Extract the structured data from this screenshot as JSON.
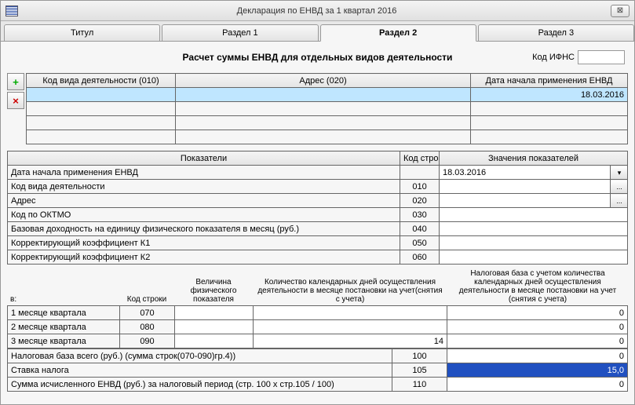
{
  "window": {
    "title": "Декларация по ЕНВД за 1 квартал 2016"
  },
  "tabs": {
    "t0": "Титул",
    "t1": "Раздел 1",
    "t2": "Раздел 2",
    "t3": "Раздел 3"
  },
  "header": {
    "main": "Расчет суммы ЕНВД для отдельных видов деятельности",
    "kod_ifns_label": "Код ИФНС",
    "kod_ifns_value": ""
  },
  "top_grid": {
    "h0": "Код вида деятельности (010)",
    "h1": "Адрес (020)",
    "h2": "Дата начала применения ЕНВД",
    "row0": {
      "c0": "",
      "c1": "",
      "c2": "18.03.2016"
    }
  },
  "params": {
    "h_pokaz": "Показатели",
    "h_code": "Код строки",
    "h_val": "Значения показателей",
    "rows": {
      "r0": {
        "label": "Дата начала применения ЕНВД",
        "code": "",
        "val": "18.03.2016"
      },
      "r1": {
        "label": "Код вида деятельности",
        "code": "010",
        "val": ""
      },
      "r2": {
        "label": "Адрес",
        "code": "020",
        "val": ""
      },
      "r3": {
        "label": "Код по ОКТМО",
        "code": "030",
        "val": ""
      },
      "r4": {
        "label": "Базовая доходность на единицу физического показателя в месяц (руб.)",
        "code": "040",
        "val": ""
      },
      "r5": {
        "label": "Корректирующий коэффициент К1",
        "code": "050",
        "val": ""
      },
      "r6": {
        "label": "Корректирующий коэффициент К2",
        "code": "060",
        "val": ""
      }
    }
  },
  "month": {
    "h_v": "в:",
    "h_code": "Код строки",
    "h_phys": "Величина физического показателя",
    "h_days": "Количество календарных дней осуществления деятельности в месяце постановки на учет(снятия с учета)",
    "h_base": "Налоговая база с учетом количества календарных дней осуществления деятельности в месяце постановки на учет (снятия с учета)",
    "r0": {
      "label": "1 месяце квартала",
      "code": "070",
      "phys": "",
      "days": "",
      "base": "0"
    },
    "r1": {
      "label": "2 месяце квартала",
      "code": "080",
      "phys": "",
      "days": "",
      "base": "0"
    },
    "r2": {
      "label": "3 месяце квартала",
      "code": "090",
      "phys": "",
      "days": "14",
      "base": "0"
    }
  },
  "summary": {
    "r0": {
      "label": "Налоговая база всего (руб.) (сумма строк(070-090)гр.4))",
      "code": "100",
      "val": "0"
    },
    "r1": {
      "label": "Ставка налога",
      "code": "105",
      "val": "15,0"
    },
    "r2": {
      "label": "Сумма исчисленного ЕНВД (руб.) за налоговый период (стр. 100 х стр.105 / 100)",
      "code": "110",
      "val": "0"
    }
  },
  "icons": {
    "plus": "+",
    "del": "×",
    "dropdown": "▾",
    "ellipsis": "..."
  }
}
